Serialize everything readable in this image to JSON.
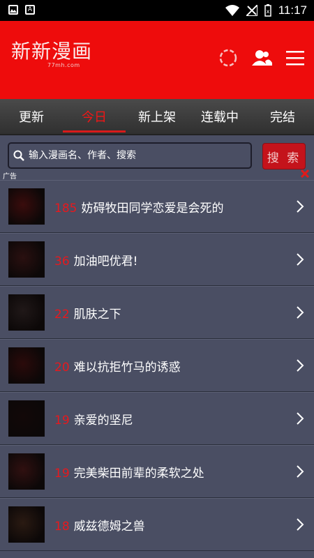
{
  "status_bar": {
    "time": "11:17"
  },
  "header": {
    "logo": "新新漫画",
    "logo_sub": "77mh.com"
  },
  "tabs": [
    {
      "label": "更新"
    },
    {
      "label": "今日"
    },
    {
      "label": "新上架"
    },
    {
      "label": "连载中"
    },
    {
      "label": "完结"
    }
  ],
  "active_tab": 1,
  "search": {
    "placeholder": "输入漫画名、作者、搜索",
    "button_label": "搜 索"
  },
  "ad_label": "广告",
  "items": [
    {
      "rank": "185",
      "title": "妨碍牧田同学恋爱是会死的",
      "thumb_color": "#3a0c0c"
    },
    {
      "rank": "36",
      "title": "加油吧优君!",
      "thumb_color": "#2a1010"
    },
    {
      "rank": "22",
      "title": "肌肤之下",
      "thumb_color": "#201818"
    },
    {
      "rank": "20",
      "title": "难以抗拒竹马的诱惑",
      "thumb_color": "#2b0a0a"
    },
    {
      "rank": "19",
      "title": "亲爱的坚尼",
      "thumb_color": "#120808"
    },
    {
      "rank": "19",
      "title": "完美柴田前辈的柔软之处",
      "thumb_color": "#301010"
    },
    {
      "rank": "18",
      "title": "威兹德姆之兽",
      "thumb_color": "#2a1a12"
    }
  ],
  "colors": {
    "header": "#ee0c0c",
    "accent": "#e6191e",
    "list_bg": "#4a4e63"
  }
}
